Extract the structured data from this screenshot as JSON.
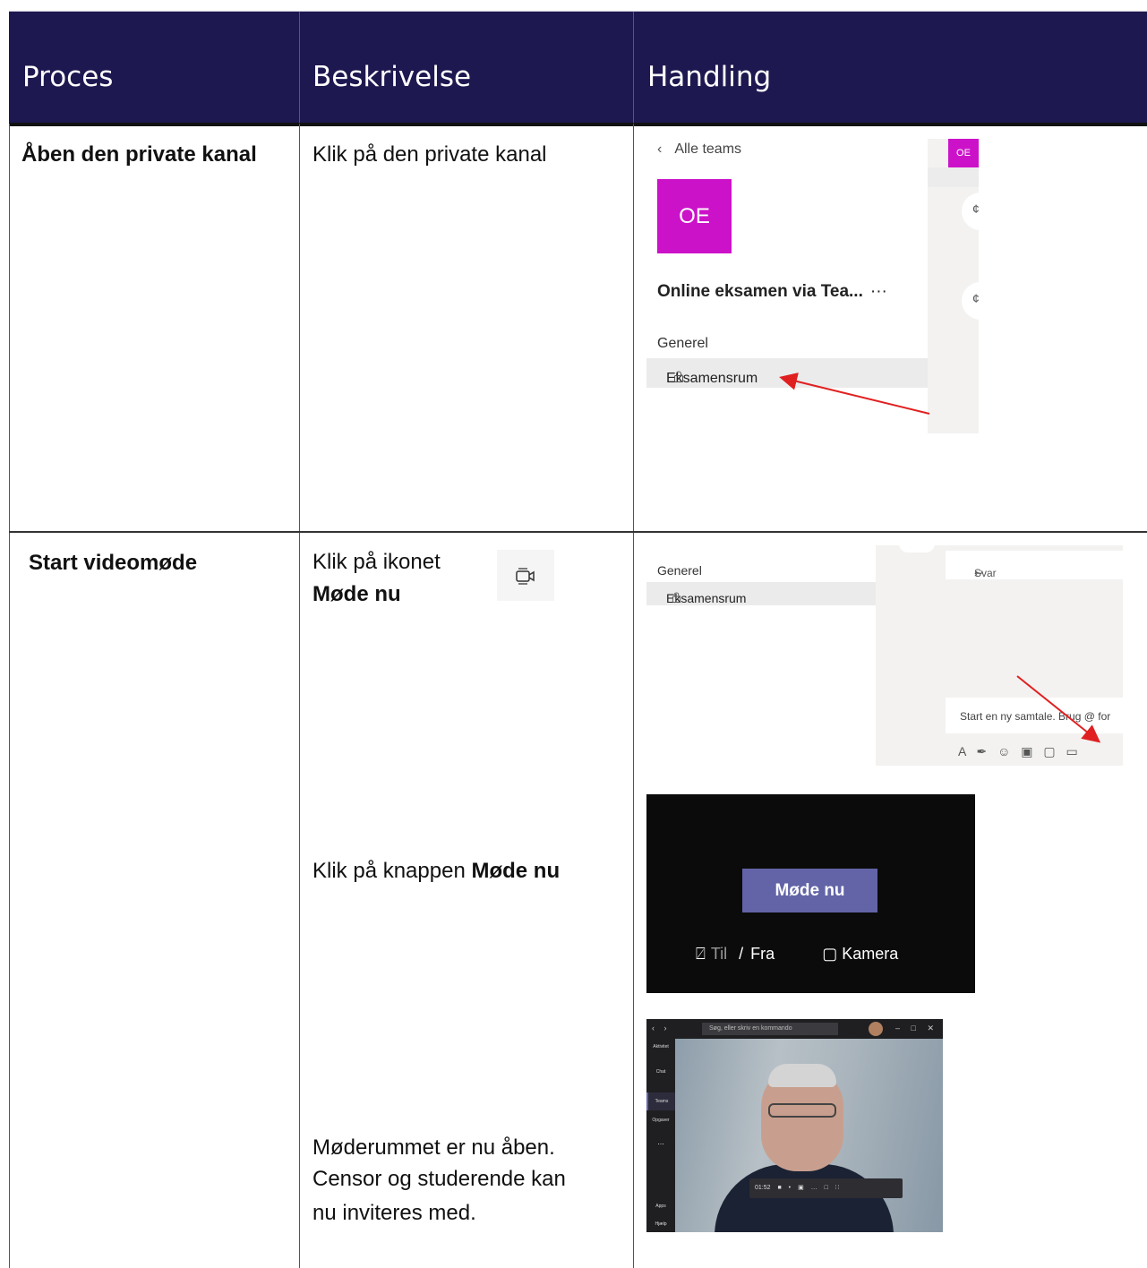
{
  "header": {
    "col1": "Proces",
    "col2": "Beskrivelse",
    "col3": "Handling"
  },
  "row1": {
    "process": "Åben den private kanal",
    "description": "Klik på den private kanal",
    "screenshot": {
      "back_label": "Alle teams",
      "tile_initials": "OE",
      "team_name": "Online eksamen via Tea...",
      "more": "···",
      "channel_general": "Generel",
      "channel_private": "Eksamensrum",
      "strip_initials": "OE"
    }
  },
  "row2": {
    "process": "Start videomøde",
    "desc1_line1": "Klik på ikonet",
    "desc1_line2": "Møde nu",
    "desc2_prefix": "Klik på knappen ",
    "desc2_bold": "Møde nu",
    "desc3_line1": "Møderummet er nu åben.",
    "desc3_line2": "Censor og studerende kan",
    "desc3_line3": "nu inviteres med.",
    "composer": {
      "channel_general": "Generel",
      "channel_private": "Eksamensrum",
      "reply": "Svar",
      "placeholder": "Start en ny samtale. Brug @ for"
    },
    "meet_dialog": {
      "button": "Møde nu",
      "til": "Til",
      "separator": "/",
      "fra": "Fra",
      "camera": "Kamera"
    },
    "meeting": {
      "search_placeholder": "Søg, eller skriv en kommando",
      "timer": "01:52",
      "rail": [
        "Aktivitet",
        "Chat",
        "Teams",
        "Opgaver",
        "...",
        "Apps",
        "Hjælp"
      ]
    }
  },
  "colors": {
    "header_bg": "#1e1850",
    "teams_magenta": "#cc12c9",
    "teams_purple": "#6264a7",
    "arrow_red": "#e02020"
  }
}
